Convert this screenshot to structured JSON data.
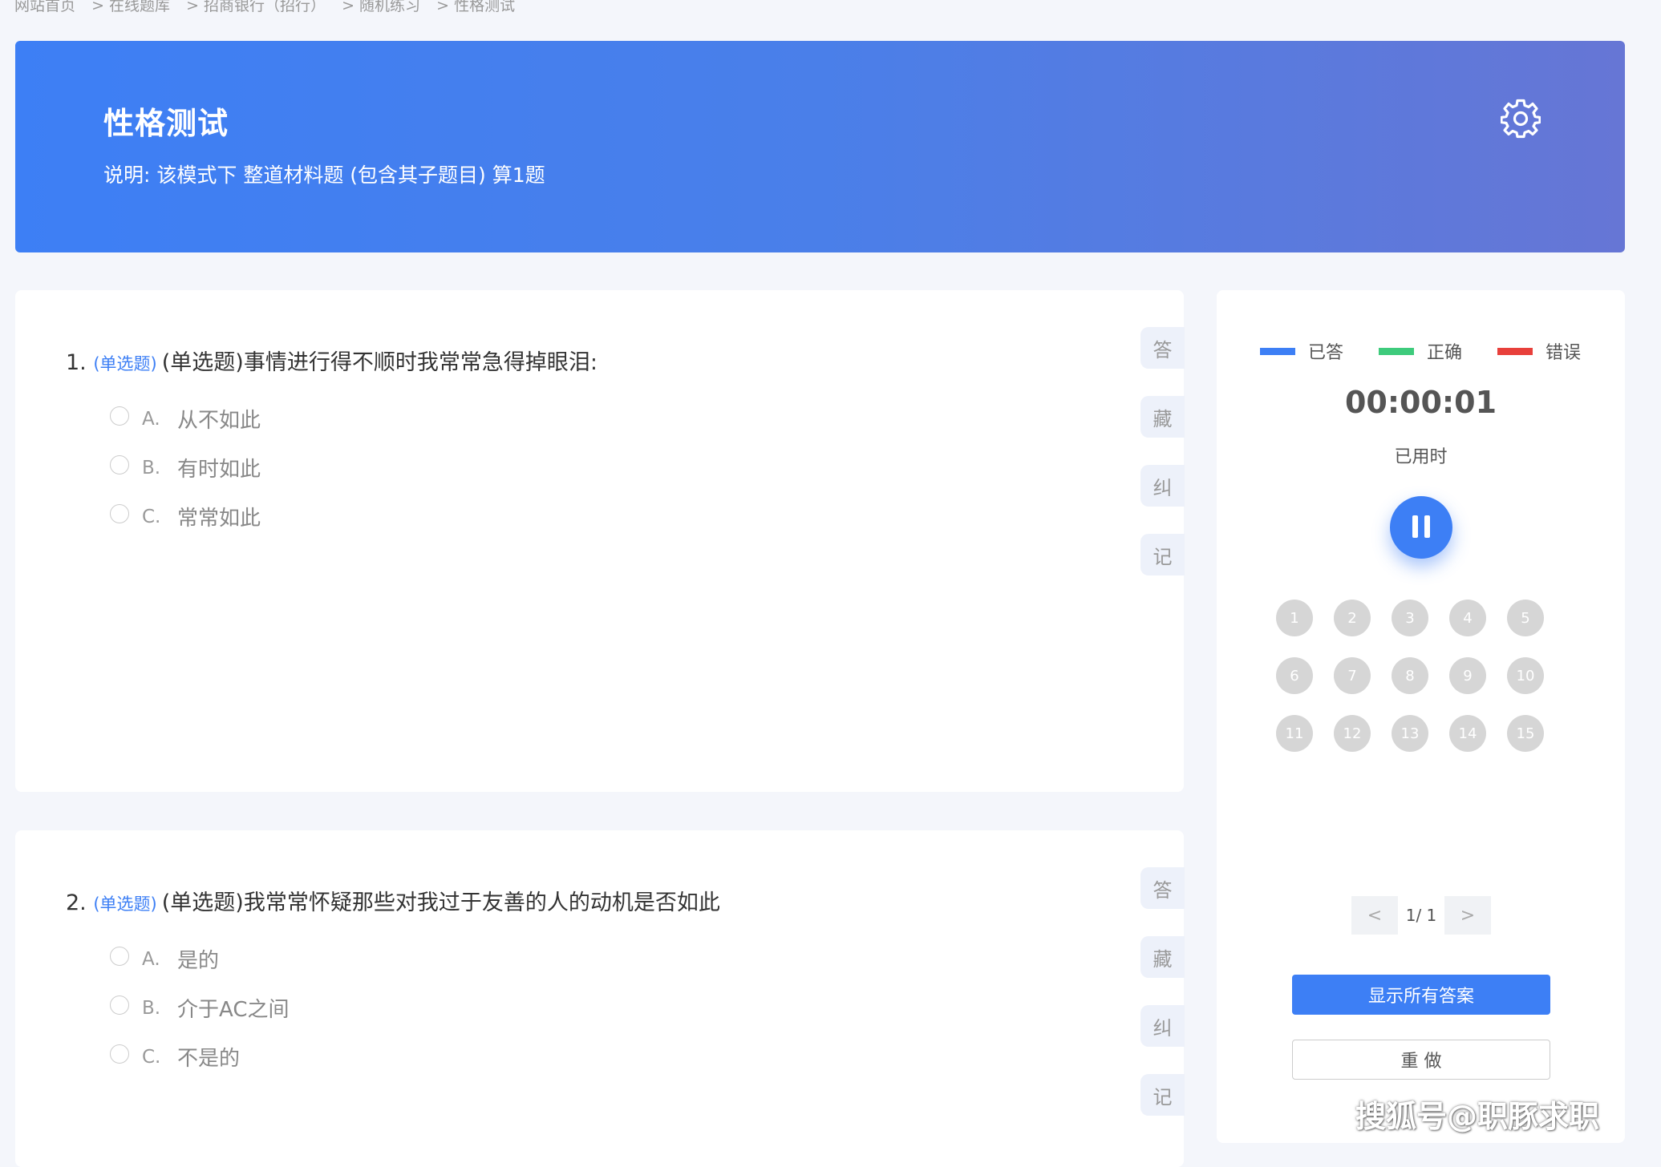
{
  "breadcrumb": [
    "网站首页",
    "> 在线题库",
    "> 招商银行（招行）",
    "> 随机练习",
    "> 性格测试"
  ],
  "banner": {
    "title": "性格测试",
    "description": "说明:   该模式下 整道材料题 (包含其子题目) 算1题",
    "settings_icon": "gear-icon"
  },
  "questions": [
    {
      "number": "1.",
      "type": "(单选题)",
      "text": "(单选题)事情进行得不顺时我常常急得掉眼泪:",
      "options": [
        {
          "letter": "A.",
          "text": "从不如此"
        },
        {
          "letter": "B.",
          "text": "有时如此"
        },
        {
          "letter": "C.",
          "text": "常常如此"
        }
      ]
    },
    {
      "number": "2.",
      "type": "(单选题)",
      "text": "(单选题)我常常怀疑那些对我过于友善的人的动机是否如此",
      "options": [
        {
          "letter": "A.",
          "text": "是的"
        },
        {
          "letter": "B.",
          "text": "介于AC之间"
        },
        {
          "letter": "C.",
          "text": "不是的"
        }
      ]
    }
  ],
  "side_tools": [
    "答",
    "藏",
    "纠",
    "记"
  ],
  "legend": [
    {
      "label": "已答",
      "color": "#3d7ff5"
    },
    {
      "label": "正确",
      "color": "#3ecb7c"
    },
    {
      "label": "错误",
      "color": "#e8403b"
    }
  ],
  "timer": {
    "value": "00:00:01",
    "label": "已用时"
  },
  "question_numbers": [
    "1",
    "2",
    "3",
    "4",
    "5",
    "6",
    "7",
    "8",
    "9",
    "10",
    "11",
    "12",
    "13",
    "14",
    "15"
  ],
  "pager": {
    "prev": "<",
    "text": "1/ 1",
    "next": ">"
  },
  "buttons": {
    "show_answers": "显示所有答案",
    "redo": "重 做"
  },
  "watermark": "搜狐号@职豚求职"
}
